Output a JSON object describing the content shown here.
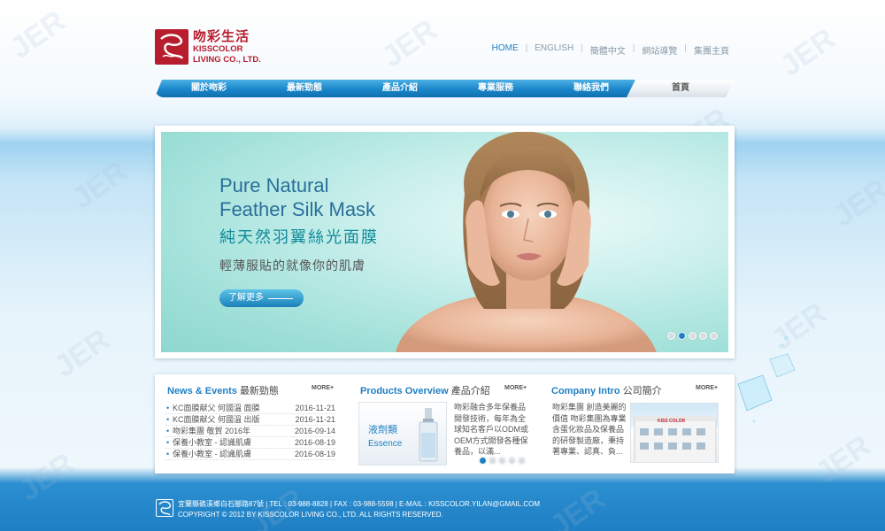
{
  "brand": {
    "cn_name": "吻彩生活",
    "en_line1": "KISSCOLOR",
    "en_line2": "LIVING CO., LTD."
  },
  "top_nav": [
    "HOME",
    "ENGLISH",
    "簡體中文",
    "網站導覽",
    "集團主頁"
  ],
  "main_menu": [
    "關於吻彩",
    "最新勁態",
    "產品介紹",
    "專業服務",
    "聯絡我們",
    "首頁"
  ],
  "banner": {
    "en_line1": "Pure Natural",
    "en_line2": "Feather Silk Mask",
    "cn_title": "純天然羽翼絲光面膜",
    "cn_sub": "輕薄服貼的就像你的肌膚",
    "button": "了解更多",
    "slide_count": 5,
    "active_slide": 1
  },
  "news": {
    "title_en": "News & Events",
    "title_cn": "最新勁態",
    "more": "MORE+",
    "items": [
      {
        "title": "KC面膜献父 何國溫 面膜",
        "date": "2016-11-21"
      },
      {
        "title": "KC面膜献父 何國溫 出版",
        "date": "2016-11-21"
      },
      {
        "title": "吻彩集團 敬賀 2016年",
        "date": "2016-09-14"
      },
      {
        "title": "保養小教室 - 認識肌膚",
        "date": "2016-08-19"
      },
      {
        "title": "保養小教室 - 認識肌膚",
        "date": "2016-08-19"
      }
    ]
  },
  "products": {
    "title_en": "Products Overview",
    "title_cn": "產品介紹",
    "more": "MORE+",
    "image_cn": "液劑類",
    "image_en": "Essence",
    "description": "吻彩融合多年保養品開發技術，每年為全球知名客戶以ODM或OEM方式開發各種保養品，以滿...",
    "slide_count": 5,
    "active_slide": 0
  },
  "company": {
    "title_en": "Company Intro",
    "title_cn": "公司簡介",
    "more": "MORE+",
    "description": "吻彩集團 創造美麗的價值 吻彩集團為專業含蛋化妝品及保養品的研發製造廠，秉持 著專業、認真、負...",
    "sign_text": "KISS COLOR"
  },
  "footer": {
    "line1": "宜蘭縣礁溪鄉白石腳路87號 | TEL : 03-988-8828 | FAX : 03-988-5598 | E-MAIL : KISSCOLOR.YILAN@GMAIL.COM",
    "line2": "COPYRIGHT © 2012 BY KISSCOLOR LIVING CO., LTD. ALL RIGHTS RESERVED."
  },
  "watermark_text": "JER",
  "colors": {
    "brand_red": "#b81d2e",
    "accent_blue": "#1f7fc4",
    "footer_blue": "#2b8fd0"
  }
}
